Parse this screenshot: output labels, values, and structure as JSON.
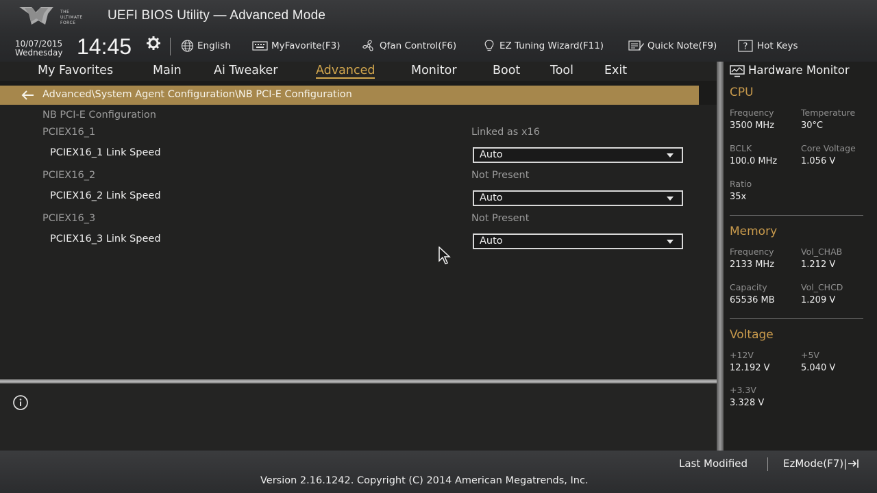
{
  "header": {
    "title": "UEFI BIOS Utility — Advanced Mode",
    "logo_text": "THE ULTIMATE FORCE",
    "date": "10/07/2015",
    "weekday": "Wednesday",
    "time": "14:45",
    "toolbar": [
      {
        "label": "English",
        "icon": "globe-icon"
      },
      {
        "label": "MyFavorite(F3)",
        "icon": "keyboard-icon"
      },
      {
        "label": "Qfan Control(F6)",
        "icon": "fan-icon"
      },
      {
        "label": "EZ Tuning Wizard(F11)",
        "icon": "lightbulb-icon"
      },
      {
        "label": "Quick Note(F9)",
        "icon": "note-icon"
      },
      {
        "label": "Hot Keys",
        "icon": "question-box-icon"
      }
    ]
  },
  "tabs": [
    {
      "label": "My Favorites"
    },
    {
      "label": "Main"
    },
    {
      "label": "Ai Tweaker"
    },
    {
      "label": "Advanced",
      "active": true
    },
    {
      "label": "Monitor"
    },
    {
      "label": "Boot"
    },
    {
      "label": "Tool"
    },
    {
      "label": "Exit"
    }
  ],
  "breadcrumb": "Advanced\\System Agent Configuration\\NB PCI-E Configuration",
  "main": {
    "section_title": "NB PCI-E Configuration",
    "slots": [
      {
        "name": "PCIEX16_1",
        "status": "Linked as x16",
        "setting_label": "PCIEX16_1 Link Speed",
        "setting_value": "Auto"
      },
      {
        "name": "PCIEX16_2",
        "status": "Not Present",
        "setting_label": "PCIEX16_2 Link Speed",
        "setting_value": "Auto"
      },
      {
        "name": "PCIEX16_3",
        "status": "Not Present",
        "setting_label": "PCIEX16_3 Link Speed",
        "setting_value": "Auto"
      }
    ]
  },
  "hardware_monitor": {
    "title": "Hardware Monitor",
    "cpu": {
      "heading": "CPU",
      "frequency_label": "Frequency",
      "frequency": "3500 MHz",
      "temperature_label": "Temperature",
      "temperature": "30°C",
      "bclk_label": "BCLK",
      "bclk": "100.0 MHz",
      "core_voltage_label": "Core Voltage",
      "core_voltage": "1.056 V",
      "ratio_label": "Ratio",
      "ratio": "35x"
    },
    "memory": {
      "heading": "Memory",
      "frequency_label": "Frequency",
      "frequency": "2133 MHz",
      "vol_chab_label": "Vol_CHAB",
      "vol_chab": "1.212 V",
      "capacity_label": "Capacity",
      "capacity": "65536 MB",
      "vol_chcd_label": "Vol_CHCD",
      "vol_chcd": "1.209 V"
    },
    "voltage": {
      "heading": "Voltage",
      "v12_label": "+12V",
      "v12": "12.192 V",
      "v5_label": "+5V",
      "v5": "5.040 V",
      "v33_label": "+3.3V",
      "v33": "3.328 V"
    }
  },
  "footer": {
    "last_modified": "Last Modified",
    "ezmode": "EzMode(F7)|",
    "version": "Version 2.16.1242. Copyright (C) 2014 American Megatrends, Inc."
  },
  "colors": {
    "accent": "#d4a84e",
    "breadcrumb_bg": "#a6874c",
    "section_heading": "#c89a4c"
  }
}
